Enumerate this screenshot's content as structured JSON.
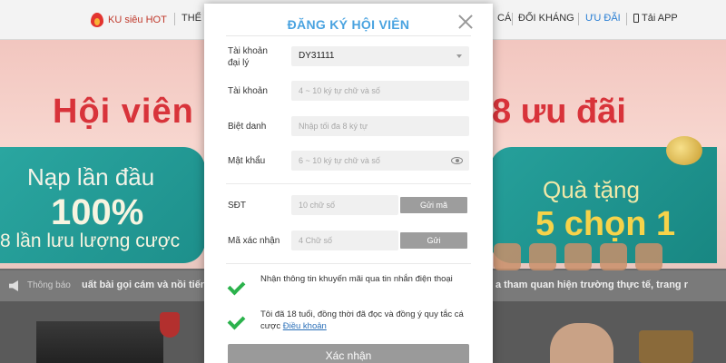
{
  "site": {
    "nav": {
      "ku_hot": "KU siêu HOT",
      "the_partial": "THỂ",
      "ca_partial": "CÁ",
      "doi_khang": "ĐỐI KHÁNG",
      "uu_dai": "ƯU ĐÃI",
      "tai_app": "Tải APP"
    },
    "banner": {
      "title_left": "Hội viên",
      "title_right": "8 ưu đãi",
      "nap_lan_dau": "Nạp lần đầu",
      "percent": "100%",
      "luu_luong": "8 lần lưu lượng cược",
      "qua_tang": "Quà tặng",
      "chon": "5 chọn 1"
    },
    "ticker": {
      "label": "Thông báo",
      "left_text": "uất bài gọi cám và nồi tiếng",
      "right_text": "a tham quan hiện trường thực tế, trang r"
    }
  },
  "modal": {
    "title": "ĐĂNG KÝ HỘI VIÊN",
    "fields": {
      "agent": {
        "label": "Tài khoản đại lý",
        "value": "DY31111"
      },
      "account": {
        "label": "Tài khoản",
        "placeholder": "4 ~ 10 ký tự chữ và số"
      },
      "nickname": {
        "label": "Biệt danh",
        "placeholder": "Nhập tối đa 8 ký tự"
      },
      "password": {
        "label": "Mật khẩu",
        "placeholder": "6 ~ 10 ký tự chữ và số"
      },
      "phone": {
        "label": "SĐT",
        "placeholder": "10 chữ số",
        "button": "Gửi mã"
      },
      "code": {
        "label": "Mã xác nhận",
        "placeholder": "4 Chữ số",
        "button": "Gửi"
      }
    },
    "checks": {
      "promo": "Nhận thông tin khuyến mãi qua tin nhắn điện thoại",
      "terms_prefix": "Tôi đã 18 tuổi, đồng thời đã đọc và đồng ý quy tắc cá cược ",
      "terms_link": "Điều khoản"
    },
    "submit": "Xác nhận"
  },
  "colors": {
    "title_blue": "#4aa3e0",
    "check_green": "#2bb24c",
    "button_gray": "#9d9d9d"
  }
}
